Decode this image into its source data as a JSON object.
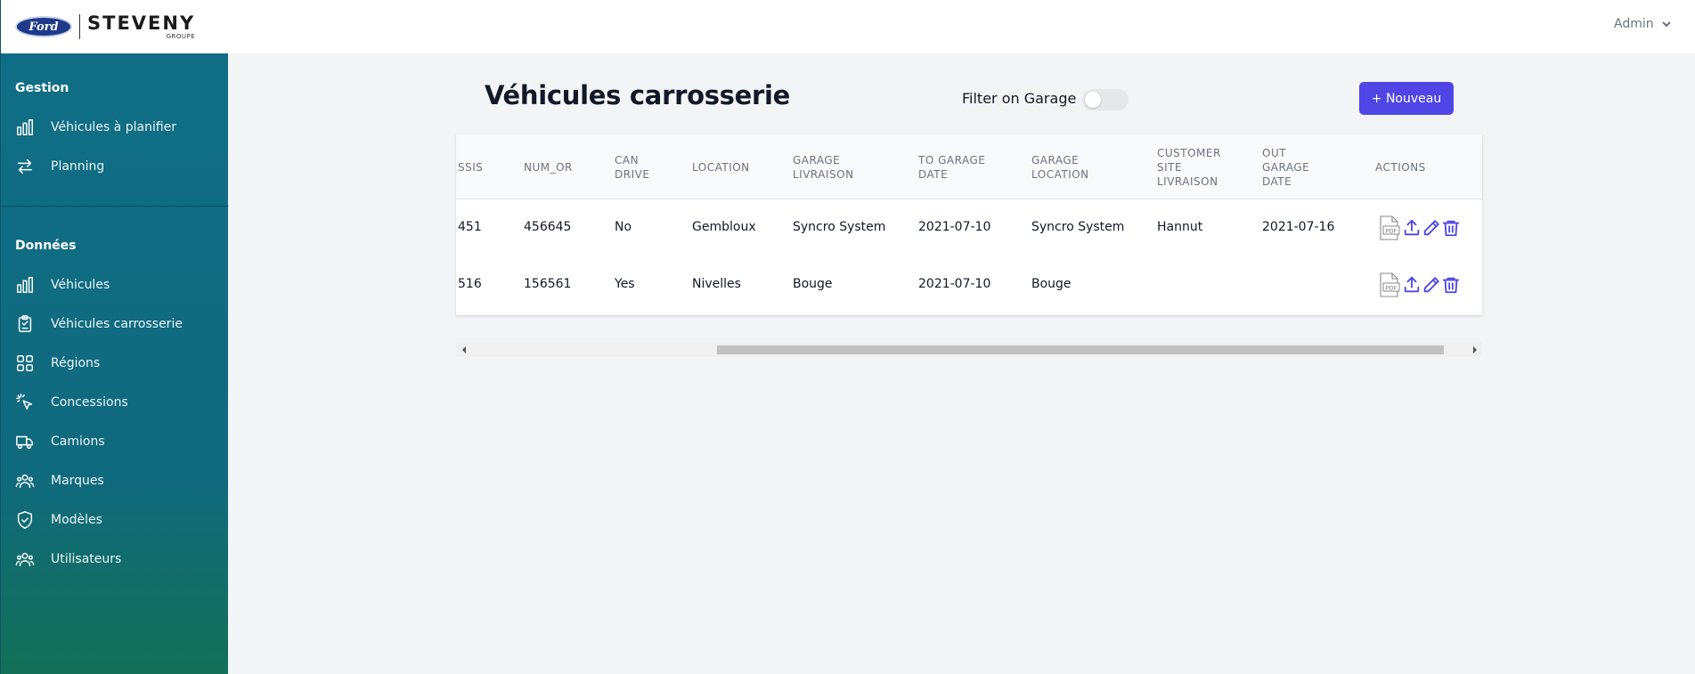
{
  "brand": {
    "oval_text": "Ford",
    "name": "STEVENY",
    "sub": "GROUPE"
  },
  "header": {
    "user": "Admin"
  },
  "sidebar": {
    "sections": [
      {
        "heading": "Gestion",
        "items": [
          {
            "label": "Véhicules à planifier",
            "icon": "bar-chart-icon"
          },
          {
            "label": "Planning",
            "icon": "switch-arrows-icon"
          }
        ]
      },
      {
        "heading": "Données",
        "items": [
          {
            "label": "Véhicules",
            "icon": "bar-chart-icon"
          },
          {
            "label": "Véhicules carrosserie",
            "icon": "clipboard-check-icon"
          },
          {
            "label": "Régions",
            "icon": "grid-icon"
          },
          {
            "label": "Concessions",
            "icon": "cursor-click-icon"
          },
          {
            "label": "Camions",
            "icon": "truck-icon"
          },
          {
            "label": "Marques",
            "icon": "user-group-icon"
          },
          {
            "label": "Modèles",
            "icon": "shield-check-icon"
          },
          {
            "label": "Utilisateurs",
            "icon": "user-group-icon"
          }
        ]
      }
    ]
  },
  "main": {
    "title": "Véhicules carrosserie",
    "filter_label": "Filter on Garage",
    "filter_on": false,
    "new_button": "+ Nouveau",
    "table": {
      "headers": [
        "SSIS",
        "NUM_OR",
        "CAN DRIVE",
        "LOCATION",
        "GARAGE LIVRAISON",
        "TO GARAGE DATE",
        "GARAGE LOCATION",
        "CUSTOMER SITE LIVRAISON",
        "OUT GARAGE DATE",
        "ACTIONS"
      ],
      "rows": [
        [
          "451",
          "456645",
          "No",
          "Gembloux",
          "Syncro System",
          "2021-07-10",
          "Syncro System",
          "Hannut",
          "2021-07-16"
        ],
        [
          "516",
          "156561",
          "Yes",
          "Nivelles",
          "Bouge",
          "2021-07-10",
          "Bouge",
          "",
          ""
        ]
      ]
    }
  },
  "colors": {
    "sidebar": "#0f6e86",
    "primary": "#4f46e5",
    "background": "#f3f4f6"
  }
}
